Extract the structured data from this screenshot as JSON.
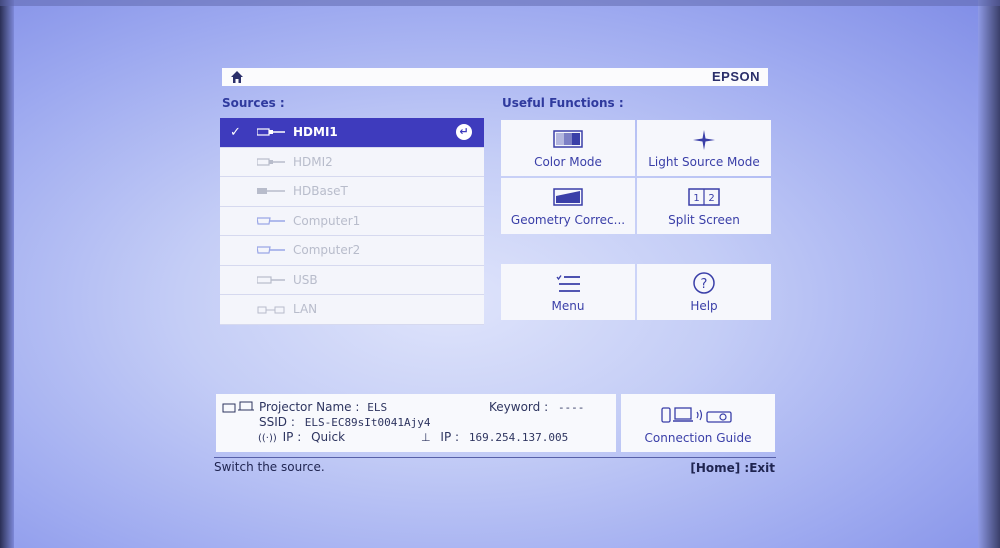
{
  "brand": "EPSON",
  "sources": {
    "title": "Sources :",
    "items": [
      {
        "label": "HDMI1",
        "selected": true
      },
      {
        "label": "HDMI2",
        "selected": false
      },
      {
        "label": "HDBaseT",
        "selected": false
      },
      {
        "label": "Computer1",
        "selected": false
      },
      {
        "label": "Computer2",
        "selected": false
      },
      {
        "label": "USB",
        "selected": false
      },
      {
        "label": "LAN",
        "selected": false
      }
    ]
  },
  "functions": {
    "title": "Useful Functions :",
    "color_mode": "Color Mode",
    "light_source_mode": "Light Source Mode",
    "geometry_correction": "Geometry Correc...",
    "split_screen": "Split Screen",
    "menu": "Menu",
    "help": "Help"
  },
  "info": {
    "projector_name_label": "Projector Name :",
    "projector_name": "ELS",
    "keyword_label": "Keyword :",
    "keyword": "----",
    "ssid_label": "SSID :",
    "ssid": "ELS-EC89sIt0041Ajy4",
    "ip_label": "IP :",
    "ip_mode": "Quick",
    "wired_ip_label": "IP :",
    "wired_ip": "169.254.137.005"
  },
  "connection_guide": "Connection Guide",
  "status_text": "Switch the source.",
  "exit_hint": "[Home] :Exit",
  "colors": {
    "accent": "#3e3bbd",
    "text_blue": "#3a3fa8"
  }
}
